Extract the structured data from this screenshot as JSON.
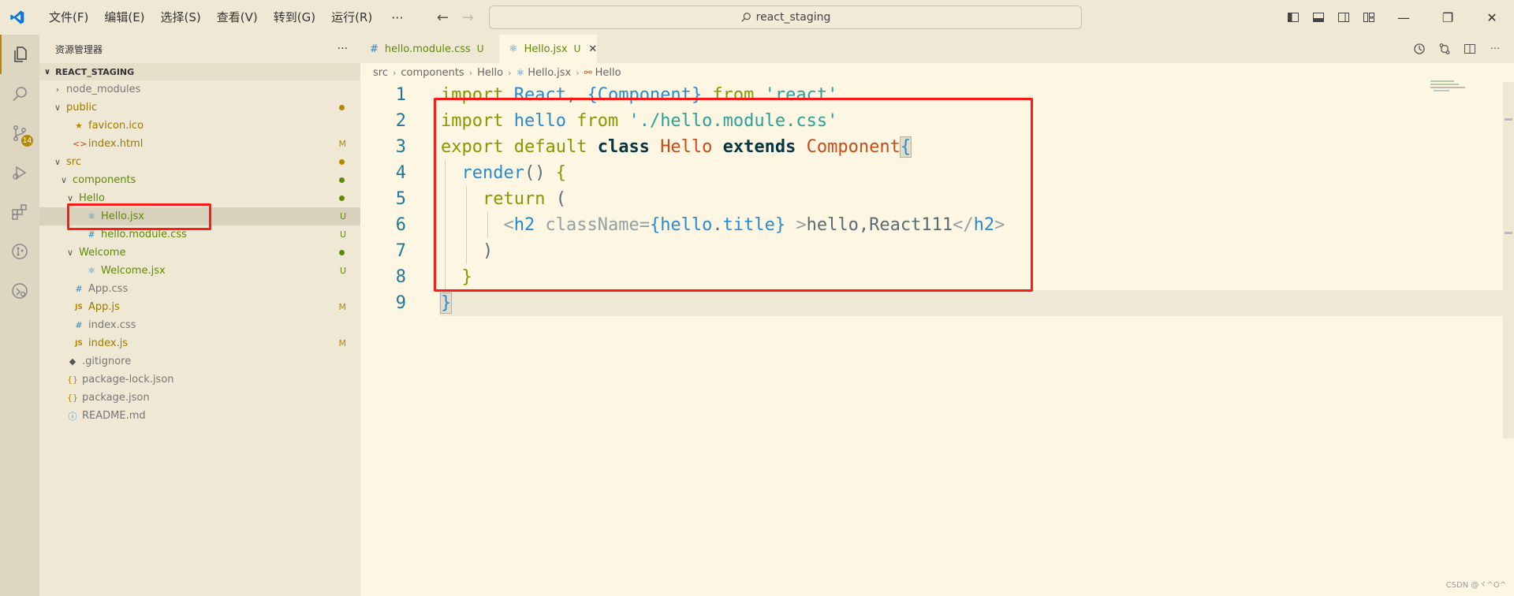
{
  "titlebar": {
    "menus": [
      "文件(F)",
      "编辑(E)",
      "选择(S)",
      "查看(V)",
      "转到(G)",
      "运行(R)"
    ],
    "more": "···",
    "search_text": "react_staging",
    "window_controls": [
      "minimize",
      "restore",
      "close"
    ]
  },
  "activity": {
    "scm_badge": "14"
  },
  "sidebar": {
    "title": "资源管理器",
    "more": "···",
    "section": "REACT_STAGING",
    "tree": [
      {
        "label": "node_modules",
        "type": "folder-closed",
        "depth": 0,
        "color": "gray"
      },
      {
        "label": "public",
        "type": "folder-open",
        "depth": 0,
        "color": "olive",
        "dot": "#b58900"
      },
      {
        "label": "favicon.ico",
        "type": "file",
        "depth": 1,
        "icon": "★",
        "iconColor": "#b58900",
        "color": "olive"
      },
      {
        "label": "index.html",
        "type": "file",
        "depth": 1,
        "icon": "<>",
        "iconColor": "#cb4b16",
        "color": "olive",
        "status": "M"
      },
      {
        "label": "src",
        "type": "folder-open",
        "depth": 0,
        "color": "olive",
        "dot": "#b58900"
      },
      {
        "label": "components",
        "type": "folder-open",
        "depth": 1,
        "color": "green",
        "dot": "#5f8a00"
      },
      {
        "label": "Hello",
        "type": "folder-open",
        "depth": 2,
        "color": "green",
        "dot": "#5f8a00"
      },
      {
        "label": "Hello.jsx",
        "type": "file",
        "depth": 3,
        "icon": "⚛",
        "iconColor": "#268bd2",
        "color": "green",
        "status": "U",
        "selected": true
      },
      {
        "label": "hello.module.css",
        "type": "file",
        "depth": 3,
        "icon": "#",
        "iconColor": "#268bd2",
        "color": "green",
        "status": "U"
      },
      {
        "label": "Welcome",
        "type": "folder-open",
        "depth": 2,
        "color": "green",
        "dot": "#5f8a00"
      },
      {
        "label": "Welcome.jsx",
        "type": "file",
        "depth": 3,
        "icon": "⚛",
        "iconColor": "#268bd2",
        "color": "green",
        "status": "U"
      },
      {
        "label": "App.css",
        "type": "file",
        "depth": 1,
        "icon": "#",
        "iconColor": "#268bd2",
        "color": "gray"
      },
      {
        "label": "App.js",
        "type": "file",
        "depth": 1,
        "icon": "JS",
        "iconColor": "#b58900",
        "color": "olive",
        "status": "M"
      },
      {
        "label": "index.css",
        "type": "file",
        "depth": 1,
        "icon": "#",
        "iconColor": "#268bd2",
        "color": "gray"
      },
      {
        "label": "index.js",
        "type": "file",
        "depth": 1,
        "icon": "JS",
        "iconColor": "#b58900",
        "color": "olive",
        "status": "M"
      },
      {
        "label": ".gitignore",
        "type": "file",
        "depth": 0,
        "icon": "◆",
        "iconColor": "#555",
        "color": "gray"
      },
      {
        "label": "package-lock.json",
        "type": "file",
        "depth": 0,
        "icon": "{}",
        "iconColor": "#b58900",
        "color": "gray"
      },
      {
        "label": "package.json",
        "type": "file",
        "depth": 0,
        "icon": "{}",
        "iconColor": "#b58900",
        "color": "gray"
      },
      {
        "label": "README.md",
        "type": "file",
        "depth": 0,
        "icon": "ⓘ",
        "iconColor": "#268bd2",
        "color": "gray"
      }
    ]
  },
  "tabs": [
    {
      "label": "hello.module.css",
      "status": "U",
      "icon": "#"
    },
    {
      "label": "Hello.jsx",
      "status": "U",
      "icon": "⚛",
      "close": "✕"
    }
  ],
  "breadcrumb": [
    "src",
    "components",
    "Hello",
    "Hello.jsx",
    "Hello"
  ],
  "code": {
    "line_numbers": [
      "1",
      "2",
      "3",
      "4",
      "5",
      "6",
      "7",
      "8",
      "9"
    ]
  },
  "watermark": "CSDN @ヾ^O^"
}
